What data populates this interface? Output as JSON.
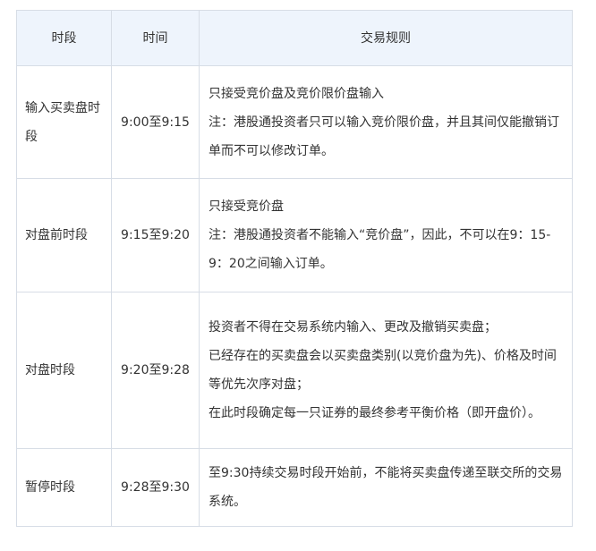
{
  "table": {
    "headers": [
      "时段",
      "时间",
      "交易规则"
    ],
    "rows": [
      {
        "period": "输入买卖盘时段",
        "time": "9:00至9:15",
        "rules": [
          "只接受竞价盘及竞价限价盘输入",
          "注：港股通投资者只可以输入竞价限价盘，并且其间仅能撤销订单而不可以修改订单。"
        ]
      },
      {
        "period": "对盘前时段",
        "time": "9:15至9:20",
        "rules": [
          "只接受竞价盘",
          "注：港股通投资者不能输入“竞价盘”，因此，不可以在9：15-9：20之间输入订单。"
        ]
      },
      {
        "period": "对盘时段",
        "time": "9:20至9:28",
        "rules": [
          "投资者不得在交易系统内输入、更改及撤销买卖盘；",
          "已经存在的买卖盘会以买卖盘类别(以竞价盘为先)、价格及时间等优先次序对盘；",
          "在此时段确定每一只证券的最终参考平衡价格（即开盘价）。"
        ]
      },
      {
        "period": "暂停时段",
        "time": "9:28至9:30",
        "rules": [
          "至9:30持续交易时段开始前，不能将买卖盘传递至联交所的交易系统。"
        ]
      }
    ]
  },
  "colors": {
    "header_background": "#eef4fc",
    "border": "#d7dde6",
    "text": "#333333"
  }
}
